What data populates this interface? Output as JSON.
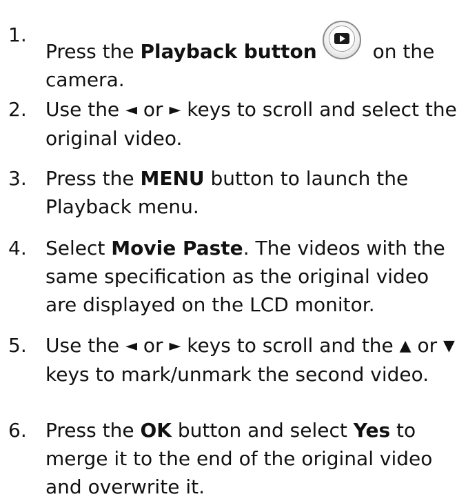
{
  "icons": {
    "playback_button": "playback-button-icon",
    "left_arrow": "◄",
    "right_arrow": "►",
    "up_arrow": "▲",
    "down_arrow": "▼"
  },
  "steps": [
    {
      "num": "1.",
      "before": "Press the ",
      "bold": "Playback button",
      "after": " on the camera."
    },
    {
      "num": "2.",
      "before": "Use the ",
      "mid": " or ",
      "after": " keys to scroll and select the original video."
    },
    {
      "num": "3.",
      "before": "Press the ",
      "bold": "MENU",
      "after": " button to launch the Playback menu."
    },
    {
      "num": "4.",
      "before": "Select ",
      "bold": "Movie Paste",
      "after": ". The videos with the same specification as the original video are displayed on the LCD monitor."
    },
    {
      "num": "5.",
      "before": "Use the ",
      "mid1": " or ",
      "mid2": " keys to scroll and the ",
      "mid3": " or ",
      "after": " keys to mark/unmark the second video."
    },
    {
      "num": "6.",
      "before": "Press the ",
      "bold1": "OK",
      "mid": " button and select ",
      "bold2": "Yes",
      "after": " to merge it to the end of the original video and overwrite it."
    }
  ]
}
